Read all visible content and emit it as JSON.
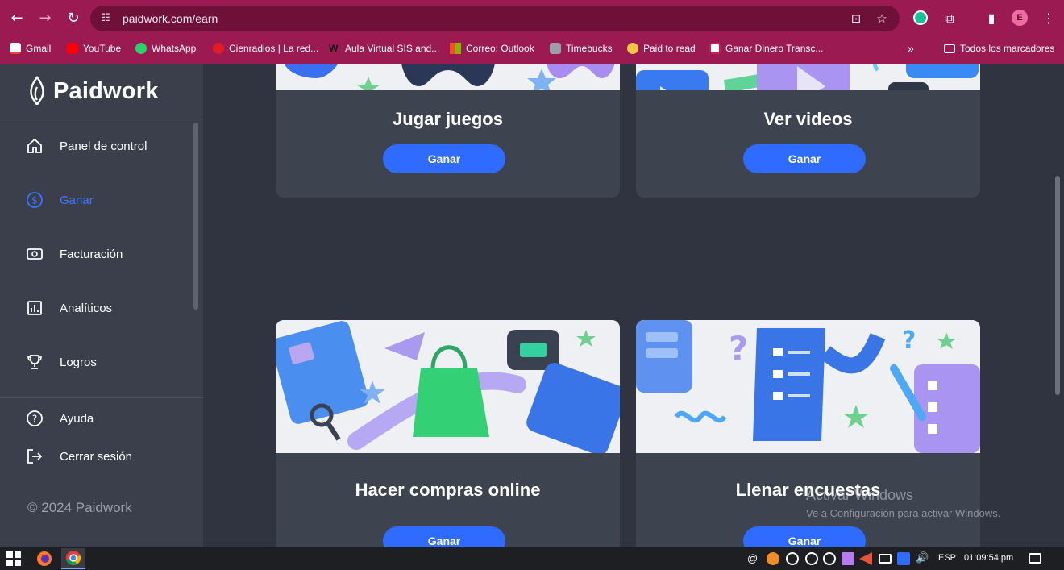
{
  "browser": {
    "url": "paidwork.com/earn",
    "bookmarks": [
      {
        "label": "Gmail",
        "icon": "gmail-icon",
        "color": "#ea4335"
      },
      {
        "label": "YouTube",
        "icon": "youtube-icon",
        "color": "#ff0000"
      },
      {
        "label": "WhatsApp",
        "icon": "whatsapp-icon",
        "color": "#25d366"
      },
      {
        "label": "Cienradios | La red...",
        "icon": "cienradios-icon",
        "color": "#e31b23"
      },
      {
        "label": "Aula Virtual SIS and...",
        "icon": "aula-virtual-icon",
        "color": "#222222"
      },
      {
        "label": "Correo: Outlook",
        "icon": "outlook-icon",
        "color": "#f25022"
      },
      {
        "label": "Timebucks",
        "icon": "timebucks-icon",
        "color": "#9aa0a6"
      },
      {
        "label": "Paid to read",
        "icon": "paid-to-read-icon",
        "color": "#f4c542"
      },
      {
        "label": "Ganar Dinero Transc...",
        "icon": "ganar-dinero-icon",
        "color": "#ffffff"
      }
    ],
    "all_bookmarks_label": "Todos los marcadores",
    "profile_initial": "E"
  },
  "sidebar": {
    "brand": "Paidwork",
    "items": [
      {
        "label": "Panel de control",
        "icon": "home-icon",
        "active": false
      },
      {
        "label": "Ganar",
        "icon": "dollar-icon",
        "active": true
      },
      {
        "label": "Facturación",
        "icon": "cash-icon",
        "active": false
      },
      {
        "label": "Analíticos",
        "icon": "chart-icon",
        "active": false
      },
      {
        "label": "Logros",
        "icon": "trophy-icon",
        "active": false
      }
    ],
    "secondary": [
      {
        "label": "Ayuda",
        "icon": "help-icon"
      },
      {
        "label": "Cerrar sesión",
        "icon": "logout-icon"
      }
    ],
    "copyright": "© 2024 Paidwork"
  },
  "cards": [
    {
      "title": "Jugar juegos",
      "button": "Ganar",
      "image": "gamepads-illustration"
    },
    {
      "title": "Ver videos",
      "button": "Ganar",
      "image": "video-player-illustration"
    },
    {
      "title": "Hacer compras online",
      "button": "Ganar",
      "image": "shopping-illustration"
    },
    {
      "title": "Llenar encuestas",
      "button": "Ganar",
      "image": "survey-illustration"
    }
  ],
  "watermark": {
    "line1": "Activar Windows",
    "line2": "Ve a Configuración para activar Windows."
  },
  "taskbar": {
    "language": "ESP",
    "time": "01:09:54:pm"
  },
  "colors": {
    "chrome": "#9b1a52",
    "sidebar": "#3a3f4b",
    "main": "#2f3440",
    "card": "#3e4350",
    "accent": "#2f6bff"
  }
}
